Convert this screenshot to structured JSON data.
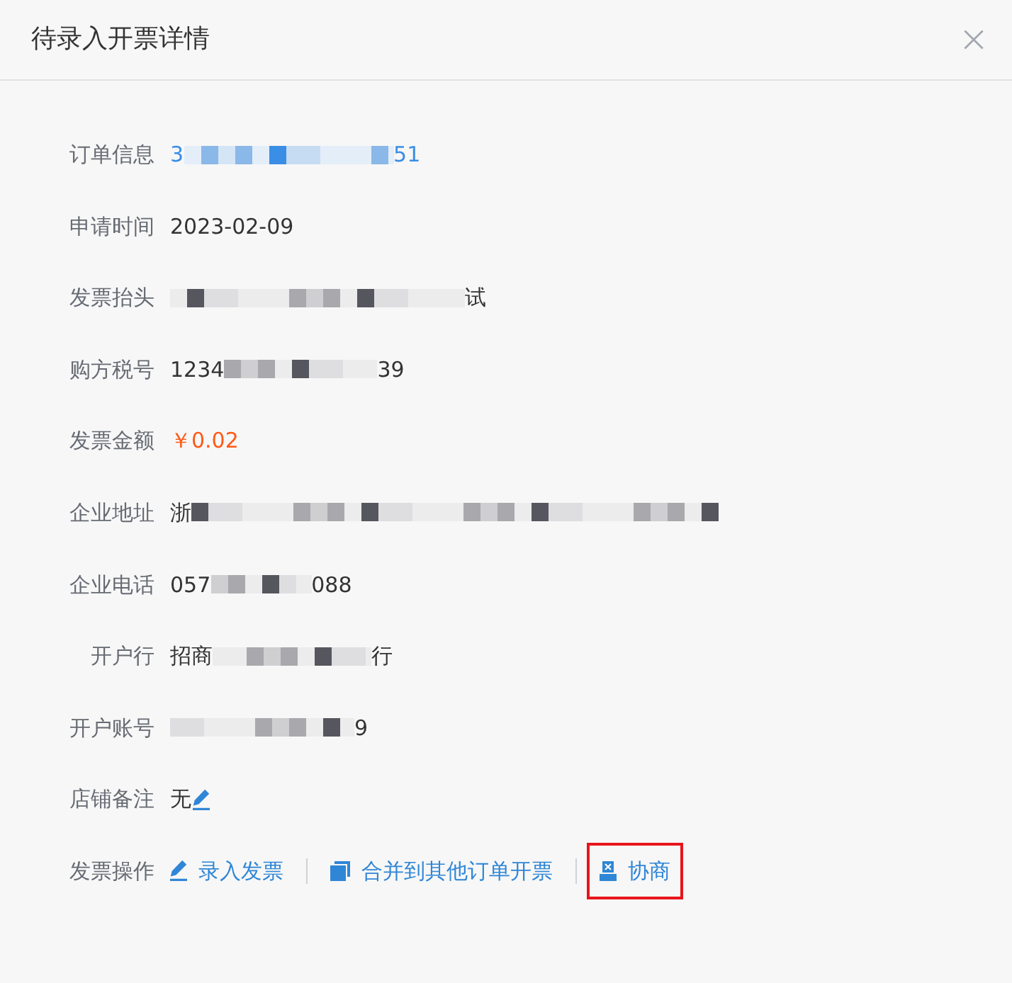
{
  "dialog": {
    "title": "待录入开票详情"
  },
  "rows": [
    {
      "label": "订单信息",
      "kind": "link",
      "segments": [
        {
          "kind": "text",
          "text": "3"
        },
        {
          "kind": "redacted"
        },
        {
          "kind": "text",
          "text": "51"
        }
      ]
    },
    {
      "label": "申请时间",
      "kind": "text",
      "segments": [
        {
          "kind": "text",
          "text": "2023-02-09"
        }
      ]
    },
    {
      "label": "发票抬头",
      "kind": "text",
      "segments": [
        {
          "kind": "redacted"
        },
        {
          "kind": "text",
          "text": "试"
        }
      ]
    },
    {
      "label": "购方税号",
      "kind": "text",
      "segments": [
        {
          "kind": "text",
          "text": "1234"
        },
        {
          "kind": "redacted"
        },
        {
          "kind": "text",
          "text": "39"
        }
      ]
    },
    {
      "label": "发票金额",
      "kind": "amount",
      "segments": [
        {
          "kind": "text",
          "text": "￥0.02"
        }
      ]
    },
    {
      "label": "企业地址",
      "kind": "text",
      "segments": [
        {
          "kind": "text",
          "text": "浙"
        },
        {
          "kind": "redacted"
        }
      ]
    },
    {
      "label": "企业电话",
      "kind": "text",
      "segments": [
        {
          "kind": "text",
          "text": "057"
        },
        {
          "kind": "redacted"
        },
        {
          "kind": "text",
          "text": "088"
        }
      ]
    },
    {
      "label": "开户行",
      "kind": "text",
      "segments": [
        {
          "kind": "text",
          "text": "招商"
        },
        {
          "kind": "redacted"
        },
        {
          "kind": "text",
          "text": "行"
        }
      ]
    },
    {
      "label": "开户账号",
      "kind": "text",
      "segments": [
        {
          "kind": "redacted"
        },
        {
          "kind": "text",
          "text": "9"
        }
      ]
    },
    {
      "label": "店铺备注",
      "kind": "note",
      "segments": [
        {
          "kind": "text",
          "text": "无"
        }
      ]
    }
  ],
  "actions": {
    "label": "发票操作",
    "items": [
      {
        "kind": "enter",
        "label": "录入发票",
        "highlighted": false
      },
      {
        "kind": "merge",
        "label": "合并到其他订单开票",
        "highlighted": false
      },
      {
        "kind": "negotiate",
        "label": "协商",
        "highlighted": true
      }
    ]
  }
}
